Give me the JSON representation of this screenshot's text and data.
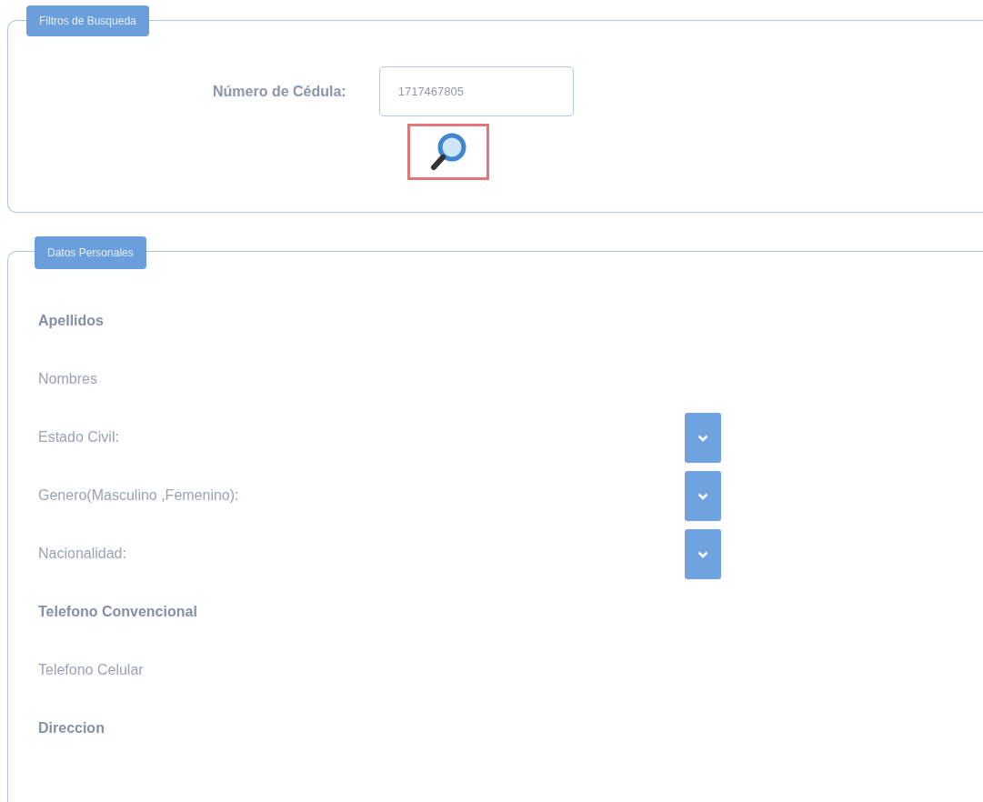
{
  "search_filters": {
    "legend": "Filtros de Busqueda",
    "label": "Número de Cédula:",
    "value": "1717467805"
  },
  "personal_data": {
    "legend": "Datos Personales",
    "fields": [
      {
        "label": "Apellidos",
        "kind": "text"
      },
      {
        "label": "Nombres",
        "kind": "text"
      },
      {
        "label": "Estado Civil:",
        "kind": "select"
      },
      {
        "label": "Genero(Masculino ,Femenino):",
        "kind": "select"
      },
      {
        "label": "Nacionalidad:",
        "kind": "select"
      },
      {
        "label": "Telefono Convencional",
        "kind": "text"
      },
      {
        "label": "Telefono Celular",
        "kind": "text"
      },
      {
        "label": "Direccion",
        "kind": "text"
      }
    ]
  }
}
